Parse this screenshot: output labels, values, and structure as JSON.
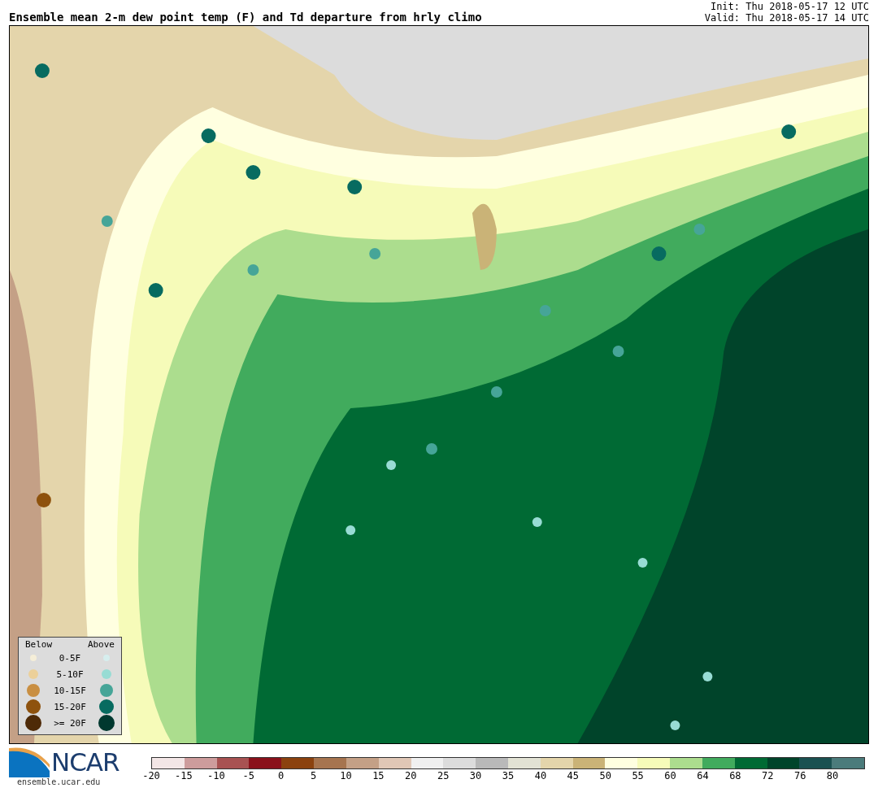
{
  "title": "Ensemble mean 2-m dew point temp (F) and Td departure from hrly climo",
  "init": "Init: Thu 2018-05-17 12 UTC",
  "valid": "Valid: Thu 2018-05-17 14 UTC",
  "legend": {
    "below_label": "Below",
    "above_label": "Above",
    "rows": [
      {
        "label": "0-5F",
        "dots": [
          {
            "color": "#f5eed8"
          },
          {
            "color": "#d6eeee"
          }
        ]
      },
      {
        "label": "5-10F",
        "dots": [
          {
            "color": "#ecd09a"
          },
          {
            "color": "#98dcd4"
          }
        ]
      },
      {
        "label": "10-15F",
        "dots": [
          {
            "color": "#c98f42"
          },
          {
            "color": "#46a598"
          }
        ]
      },
      {
        "label": "15-20F",
        "dots": [
          {
            "color": "#8e520d"
          },
          {
            "color": "#076b60"
          }
        ]
      },
      {
        "label": ">= 20F",
        "dots": [
          {
            "color": "#4e2a07"
          },
          {
            "color": "#00382f"
          }
        ]
      }
    ]
  },
  "logo": {
    "text": "NCAR",
    "url": "ensemble.ucar.edu"
  },
  "colorbar": {
    "bins": [
      {
        "color": "#f3e6e6"
      },
      {
        "color": "#cd9c9c"
      },
      {
        "color": "#a85252"
      },
      {
        "color": "#8a121b"
      },
      {
        "color": "#8b420f"
      },
      {
        "color": "#a6744f"
      },
      {
        "color": "#c4a086"
      },
      {
        "color": "#e0c7b6"
      },
      {
        "color": "#f0f0f0"
      },
      {
        "color": "#dcdcdc"
      },
      {
        "color": "#b9b9b9"
      },
      {
        "color": "#e2e2d4"
      },
      {
        "color": "#e4d5ab"
      },
      {
        "color": "#cab377"
      },
      {
        "color": "#ffffe0"
      },
      {
        "color": "#f6fbb9"
      },
      {
        "color": "#acdd8e"
      },
      {
        "color": "#41ab5d"
      },
      {
        "color": "#006a34"
      },
      {
        "color": "#00442a"
      },
      {
        "color": "#1a5151"
      },
      {
        "color": "#4b7b7b"
      }
    ],
    "ticks": [
      "-20",
      "-15",
      "-10",
      "-5",
      "0",
      "5",
      "10",
      "15",
      "20",
      "25",
      "30",
      "35",
      "40",
      "45",
      "50",
      "55",
      "60",
      "64",
      "68",
      "72",
      "76",
      "80"
    ]
  }
}
